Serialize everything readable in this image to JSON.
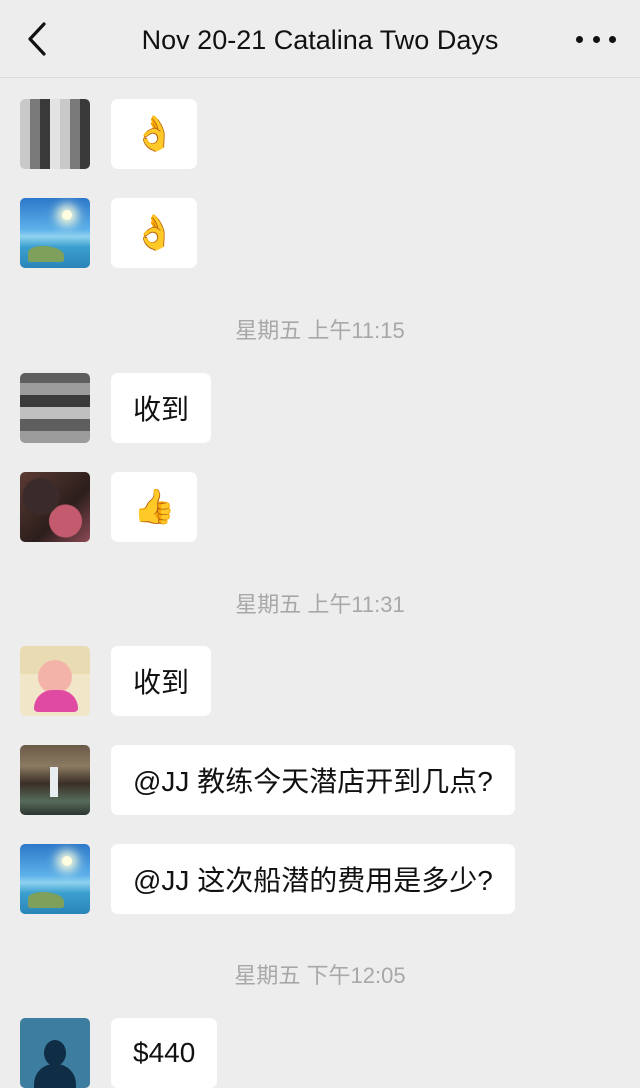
{
  "header": {
    "title": "Nov 20-21 Catalina Two Days",
    "back_icon": "chevron-left-icon",
    "more_icon": "ellipsis-icon"
  },
  "messages": [
    {
      "avatar": "blurred-person-avatar",
      "text": "👌"
    },
    {
      "avatar": "beach-avatar",
      "text": "👌"
    },
    {
      "avatar": "blurred-avatar",
      "text": "收到"
    },
    {
      "avatar": "blurred-dark-avatar",
      "text": "👍"
    },
    {
      "avatar": "cartoon-avatar",
      "text": "收到"
    },
    {
      "avatar": "waterfall-avatar",
      "text": "@JJ 教练今天潜店开到几点?"
    },
    {
      "avatar": "beach-avatar",
      "text": "@JJ 这次船潜的费用是多少?"
    },
    {
      "avatar": "silhouette-avatar",
      "text": "$440"
    }
  ],
  "timestamps": [
    "星期五 上午11:15",
    "星期五 上午11:31",
    "星期五 下午12:05"
  ]
}
